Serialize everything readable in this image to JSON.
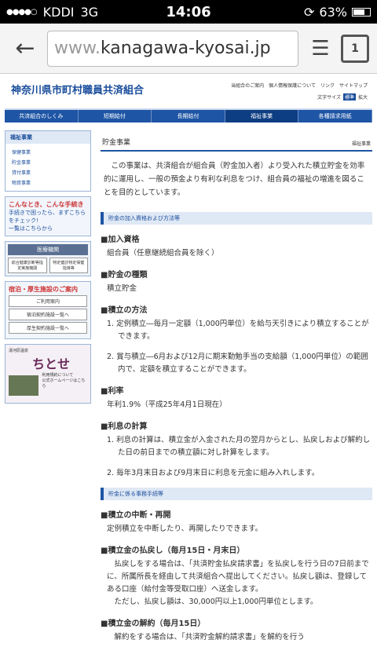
{
  "status": {
    "carrier": "KDDI",
    "network": "3G",
    "time": "14:06",
    "battery": "63%"
  },
  "browser": {
    "url_pre": "www.",
    "url_main": "kanagawa-kyosai.jp",
    "tabs_count": "1"
  },
  "site": {
    "logo": "神奈川県市町村職員共済組合",
    "header_links": [
      "当組合のご案内",
      "個人情報保護について",
      "リンク",
      "サイトマップ"
    ],
    "font_size_label": "文字サイズ",
    "font_size_std": "標準",
    "font_size_big": "拡大"
  },
  "nav": [
    "共済組合のしくみ",
    "短期給付",
    "長期給付",
    "福祉事業",
    "各種請求用紙"
  ],
  "sidebar": {
    "title": "福祉事業",
    "items": [
      "保健事業",
      "貯金事業",
      "貸付事業",
      "物資事業"
    ],
    "banner_head": "こんなとき、こんな手続き",
    "banner_text": "手続きで困ったら、まずこちらをチェック!",
    "banner_link": "一覧はこちらから",
    "medical_head": "医療機関",
    "medical_btn1": "総合健康診断等指定実施機関",
    "medical_btn2": "特定健診特定保健指導等",
    "facility_head": "宿泊・厚生施設のご案内",
    "facility_btns": [
      "ご利用案内",
      "宿泊契約施設一覧へ",
      "厚生契約施設一覧へ"
    ],
    "chitose_label": "湯河原温泉",
    "chitose_name": "ちとせ",
    "chitose_use": "利用規約について",
    "chitose_link": "公式ホームページはこちら"
  },
  "main": {
    "title": "貯金事業",
    "title_right": "福祉事業",
    "intro": "この事業は、共済組合が組合員（貯金加入者）より受入れた積立貯金を効率的に運用し、一般の預金より有利な利息をつけ、組合員の福祉の増進を図ることを目的としています。",
    "band1": "貯金の加入資格および方法等",
    "h1": "■加入資格",
    "p1": "組合員（任意継続組合員を除く）",
    "h2": "■貯金の種類",
    "p2": "積立貯金",
    "h3": "■積立の方法",
    "list3": [
      "1. 定例積立―毎月一定額（1,000円単位）を給与天引きにより積立することができます。",
      "2. 賞与積立―6月および12月に期末勤勉手当の支給額（1,000円単位）の範囲内で、定額を積立することができます。"
    ],
    "h4": "■利率",
    "p4": "年利1.9%（平成25年4月1日現在）",
    "h5": "■利息の計算",
    "list5": [
      "1. 利息の計算は、積立金が入金された月の翌月からとし、払戻しおよび解約した日の前日までの積立額に対し計算をします。",
      "2. 毎年3月末日および9月末日に利息を元金に組み入れします。"
    ],
    "band2": "貯金に係る事務手続等",
    "h6": "■積立の中断・再開",
    "p6": "定例積立を中断したり、再開したりできます。",
    "h7": "■積立金の払戻し（毎月15日・月末日）",
    "p7a": "払戻しをする場合は、「共済貯金払戻請求書」を払戻しを行う日の7日前までに、所属所長を経由して共済組合へ提出してください。払戻し額は、登録してある口座（給付金等受取口座）へ送金します。",
    "p7b": "ただし、払戻し額は、30,000円以上1,000円単位とします。",
    "h8": "■積立金の解約（毎月15日）",
    "p8": "解約をする場合は、「共済貯金解約請求書」を解約を行う"
  }
}
